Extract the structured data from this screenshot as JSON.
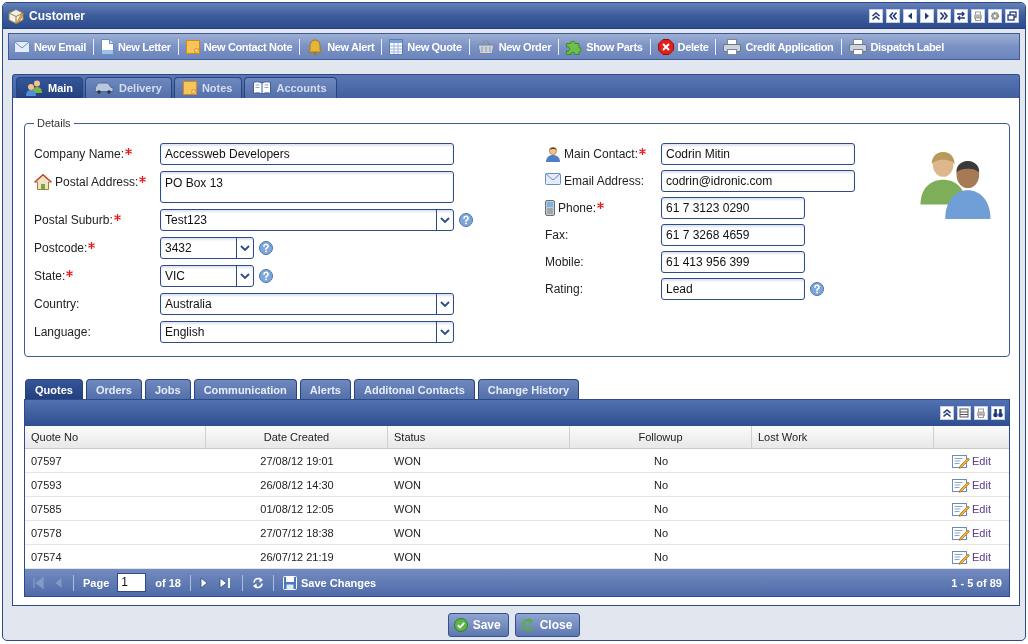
{
  "window": {
    "title": "Customer"
  },
  "toolbar": [
    {
      "label": "New Email"
    },
    {
      "label": "New Letter"
    },
    {
      "label": "New Contact Note"
    },
    {
      "label": "New Alert"
    },
    {
      "label": "New Quote"
    },
    {
      "label": "New Order"
    },
    {
      "label": "Show Parts"
    },
    {
      "label": "Delete"
    },
    {
      "label": "Credit Application"
    },
    {
      "label": "Dispatch Label"
    }
  ],
  "tabs": [
    {
      "label": "Main",
      "selected": true
    },
    {
      "label": "Delivery",
      "selected": false
    },
    {
      "label": "Notes",
      "selected": false
    },
    {
      "label": "Accounts",
      "selected": false
    }
  ],
  "details": {
    "legend": "Details",
    "left_fields": [
      {
        "label": "Company Name:",
        "required": true,
        "kind": "text",
        "value": "Accessweb Developers",
        "help": false
      },
      {
        "label": "Postal Address:",
        "required": true,
        "kind": "multiline",
        "value": "PO Box 13",
        "help": false
      },
      {
        "label": "Postal Suburb:",
        "required": true,
        "kind": "select",
        "value": "Test123",
        "help": true
      },
      {
        "label": "Postcode:",
        "required": true,
        "kind": "select",
        "value": "3432",
        "help": true
      },
      {
        "label": "State:",
        "required": true,
        "kind": "select",
        "value": "VIC",
        "help": true
      },
      {
        "label": "Country:",
        "required": false,
        "kind": "select",
        "value": "Australia",
        "help": false
      },
      {
        "label": "Language:",
        "required": false,
        "kind": "select",
        "value": "English",
        "help": false
      }
    ],
    "right_fields": [
      {
        "label": "Main Contact:",
        "required": true,
        "kind": "text",
        "value": "Codrin Mitin",
        "help": false
      },
      {
        "label": "Email Address:",
        "required": false,
        "kind": "text",
        "value": "codrin@idronic.com",
        "help": false
      },
      {
        "label": "Phone:",
        "required": true,
        "kind": "text",
        "value": "61 7 3123 0290",
        "help": false
      },
      {
        "label": "Fax:",
        "required": false,
        "kind": "text",
        "value": "61 7 3268 4659",
        "help": false
      },
      {
        "label": "Mobile:",
        "required": false,
        "kind": "text",
        "value": "61 413 956 399",
        "help": false
      },
      {
        "label": "Rating:",
        "required": false,
        "kind": "text",
        "value": "Lead",
        "help": true
      }
    ]
  },
  "grid": {
    "tabs": [
      {
        "label": "Quotes",
        "selected": true
      },
      {
        "label": "Orders",
        "selected": false
      },
      {
        "label": "Jobs",
        "selected": false
      },
      {
        "label": "Communication",
        "selected": false
      },
      {
        "label": "Alerts",
        "selected": false
      },
      {
        "label": "Additonal Contacts",
        "selected": false
      },
      {
        "label": "Change History",
        "selected": false
      }
    ],
    "columns": [
      "Quote No",
      "Date Created",
      "Status",
      "Followup",
      "Lost Work"
    ],
    "rows": [
      {
        "quote_no": "07597",
        "date_created": "27/08/12 19:01",
        "status": "WON",
        "followup": "No",
        "action": "Edit"
      },
      {
        "quote_no": "07593",
        "date_created": "26/08/12 14:30",
        "status": "WON",
        "followup": "No",
        "action": "Edit"
      },
      {
        "quote_no": "07585",
        "date_created": "01/08/12 12:05",
        "status": "WON",
        "followup": "No",
        "action": "Edit"
      },
      {
        "quote_no": "07578",
        "date_created": "27/07/12 18:38",
        "status": "WON",
        "followup": "No",
        "action": "Edit"
      },
      {
        "quote_no": "07574",
        "date_created": "26/07/12 21:19",
        "status": "WON",
        "followup": "No",
        "action": "Edit"
      }
    ],
    "paging": {
      "page_label": "Page",
      "page": "1",
      "of_pages": "of 18",
      "save_label": "Save Changes",
      "range": "1 - 5 of 89",
      "nav": [
        {
          "disabled": true
        },
        {
          "disabled": true
        },
        {
          "disabled": false
        },
        {
          "disabled": false
        }
      ]
    }
  },
  "buttons": [
    {
      "label": "Save"
    },
    {
      "label": "Close"
    }
  ]
}
